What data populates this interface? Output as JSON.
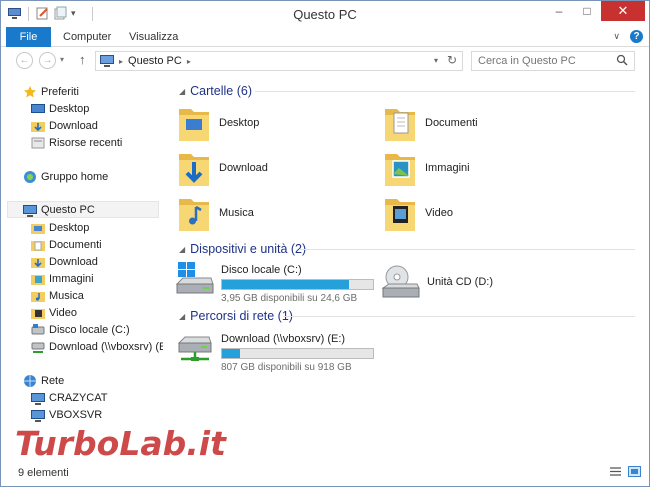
{
  "window": {
    "title": "Questo PC"
  },
  "ribbon": {
    "file": "File",
    "tabs": [
      "Computer",
      "Visualizza"
    ]
  },
  "address": {
    "crumb": "Questo PC"
  },
  "search": {
    "placeholder": "Cerca in Questo PC"
  },
  "sidebar": {
    "favorites": {
      "label": "Preferiti",
      "items": [
        "Desktop",
        "Download",
        "Risorse recenti"
      ]
    },
    "homegroup": "Gruppo home",
    "thispc": {
      "label": "Questo PC",
      "items": [
        "Desktop",
        "Documenti",
        "Download",
        "Immagini",
        "Musica",
        "Video",
        "Disco locale (C:)",
        "Download (\\\\vboxsrv) (E:)"
      ]
    },
    "network": {
      "label": "Rete",
      "items": [
        "CRAZYCAT",
        "VBOXSVR"
      ]
    }
  },
  "groups": {
    "folders": {
      "title": "Cartelle (6)",
      "items": [
        "Desktop",
        "Documenti",
        "Download",
        "Immagini",
        "Musica",
        "Video"
      ]
    },
    "devices": {
      "title": "Dispositivi e unità (2)",
      "disk_c": {
        "name": "Disco locale (C:)",
        "info": "3,95 GB disponibili su 24,6 GB",
        "used_fraction": 0.84
      },
      "cd": {
        "name": "Unità CD (D:)"
      }
    },
    "network": {
      "title": "Percorsi di rete (1)",
      "drive_e": {
        "name": "Download (\\\\vboxsrv) (E:)",
        "info": "807 GB disponibili su 918 GB",
        "used_fraction": 0.12
      }
    }
  },
  "status": {
    "count": "9 elementi"
  },
  "watermark": {
    "text": "TurboLab.it"
  }
}
